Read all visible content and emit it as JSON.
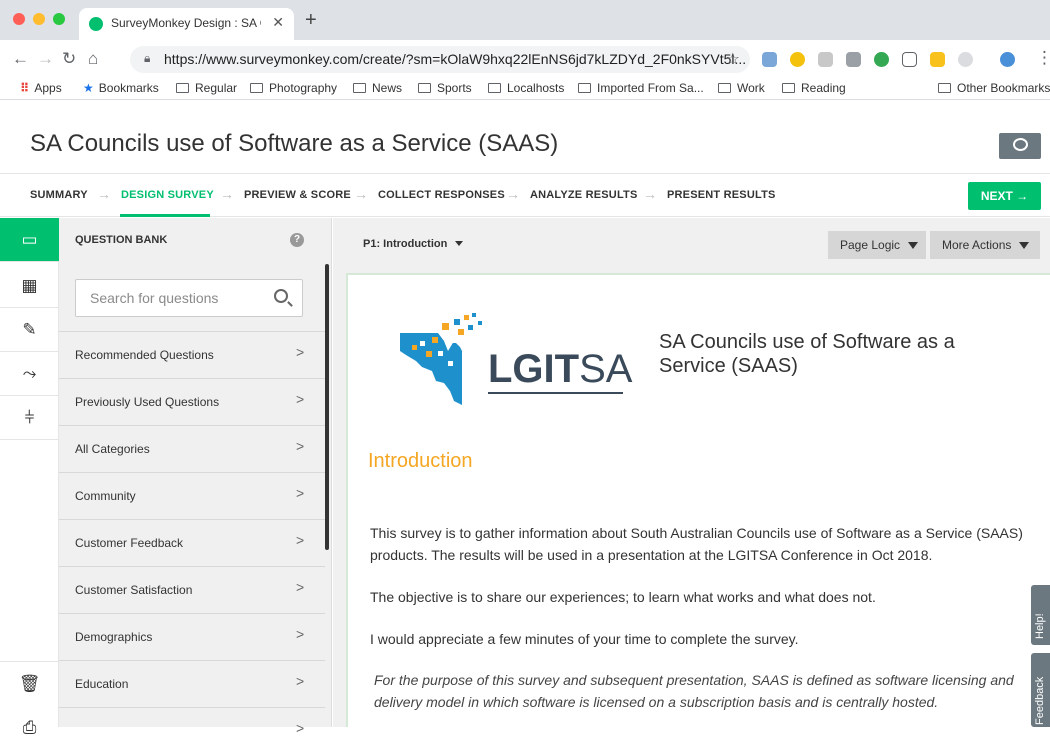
{
  "browser": {
    "tab_title": "SurveyMonkey Design : SA Cou",
    "url": "https://www.surveymonkey.com/create/?sm=kOlaW9hxq22lEnNS6jd7kLZDYd_2F0nkSYVt5l...",
    "bookmarks": [
      {
        "label": "Apps",
        "icon": "apps-grid-icon"
      },
      {
        "label": "Bookmarks",
        "icon": "star-icon"
      },
      {
        "label": "Regular",
        "icon": "folder-icon"
      },
      {
        "label": "Photography",
        "icon": "folder-icon"
      },
      {
        "label": "News",
        "icon": "folder-icon"
      },
      {
        "label": "Sports",
        "icon": "folder-icon"
      },
      {
        "label": "Localhosts",
        "icon": "folder-icon"
      },
      {
        "label": "Imported From Sa...",
        "icon": "folder-icon"
      },
      {
        "label": "Work",
        "icon": "folder-icon"
      },
      {
        "label": "Reading",
        "icon": "folder-icon"
      },
      {
        "label": "Other Bookmarks",
        "icon": "folder-icon"
      }
    ]
  },
  "header": {
    "title": "SA Councils use of Software as a Service (SAAS)"
  },
  "steps": {
    "summary": "SUMMARY",
    "design": "DESIGN SURVEY",
    "preview": "PREVIEW & SCORE",
    "collect": "COLLECT RESPONSES",
    "analyze": "ANALYZE RESULTS",
    "present": "PRESENT RESULTS",
    "next": "NEXT →"
  },
  "question_bank": {
    "title": "QUESTION BANK",
    "help": "?",
    "search_placeholder": "Search for questions",
    "items": [
      "Recommended Questions",
      "Previously Used Questions",
      "All Categories",
      "Community",
      "Customer Feedback",
      "Customer Satisfaction",
      "Demographics",
      "Education"
    ]
  },
  "main": {
    "page_selector": "P1: Introduction",
    "page_logic": "Page Logic",
    "more_actions": "More Actions",
    "logo_bold": "LGIT",
    "logo_light": "SA",
    "survey_heading": "SA Councils use of Software as a Service (SAAS)",
    "intro_heading": "Introduction",
    "paragraphs": [
      "This survey is to gather information about South Australian Councils use of Software as a Service (SAAS) products. The results will be used in a presentation at the LGITSA Conference in Oct 2018.",
      "The objective is to share our experiences; to learn what works and what does not.",
      "I would appreciate a few minutes of your time to complete the survey.",
      "For the purpose of this survey and subsequent presentation, SAAS is defined as software licensing and delivery model in which software is licensed on a subscription basis and is centrally hosted."
    ]
  },
  "side_tabs": {
    "help": "Help!",
    "feedback": "Feedback"
  },
  "colors": {
    "accent": "#00bf6f",
    "heading_orange": "#f5a623"
  }
}
